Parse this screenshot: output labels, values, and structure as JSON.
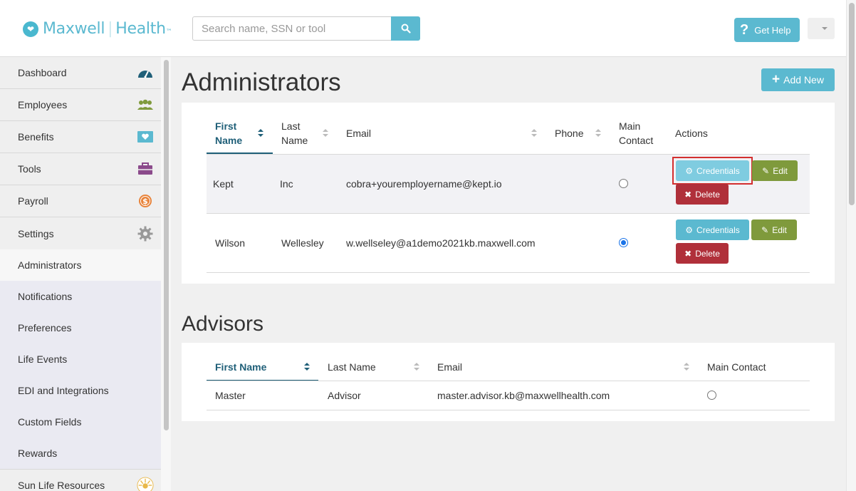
{
  "header": {
    "logo_name": "Maxwell",
    "logo_sub": "Health",
    "logo_tm": "™",
    "search_placeholder": "Search name, SSN or tool",
    "help_label": "Get Help"
  },
  "sidebar": {
    "items": [
      {
        "label": "Dashboard",
        "icon": "dashboard-gauge-icon",
        "color": "#1f5f78"
      },
      {
        "label": "Employees",
        "icon": "people-icon",
        "color": "#7f9a3c"
      },
      {
        "label": "Benefits",
        "icon": "heart-card-icon",
        "color": "#5bb9d0"
      },
      {
        "label": "Tools",
        "icon": "briefcase-icon",
        "color": "#8b4a8b"
      },
      {
        "label": "Payroll",
        "icon": "dollar-coin-icon",
        "color": "#e8833a"
      },
      {
        "label": "Settings",
        "icon": "gear-icon",
        "color": "#999999"
      }
    ],
    "sub_items": [
      "Administrators",
      "Notifications",
      "Preferences",
      "Life Events",
      "EDI and Integrations",
      "Custom Fields",
      "Rewards"
    ],
    "bottom_item": {
      "label": "Sun Life Resources",
      "icon": "sun-life-logo-icon"
    }
  },
  "administrators": {
    "title": "Administrators",
    "add_label": "Add New",
    "columns": {
      "first_name": "First Name",
      "last_name": "Last Name",
      "email": "Email",
      "phone": "Phone",
      "main_contact": "Main Contact",
      "actions": "Actions"
    },
    "rows": [
      {
        "first": "Kept",
        "last": "Inc",
        "email": "cobra+youremployername@kept.io",
        "phone": "",
        "main": false
      },
      {
        "first": "Wilson",
        "last": "Wellesley",
        "email": "w.wellseley@a1demo2021kb.maxwell.com",
        "phone": "",
        "main": true
      }
    ],
    "buttons": {
      "credentials": "Credentials",
      "edit": "Edit",
      "delete": "Delete"
    }
  },
  "advisors": {
    "title": "Advisors",
    "columns": {
      "first_name": "First Name",
      "last_name": "Last Name",
      "email": "Email",
      "main_contact": "Main Contact"
    },
    "rows": [
      {
        "first": "Master",
        "last": "Advisor",
        "email": "master.advisor.kb@maxwellhealth.com",
        "main": false
      }
    ]
  }
}
